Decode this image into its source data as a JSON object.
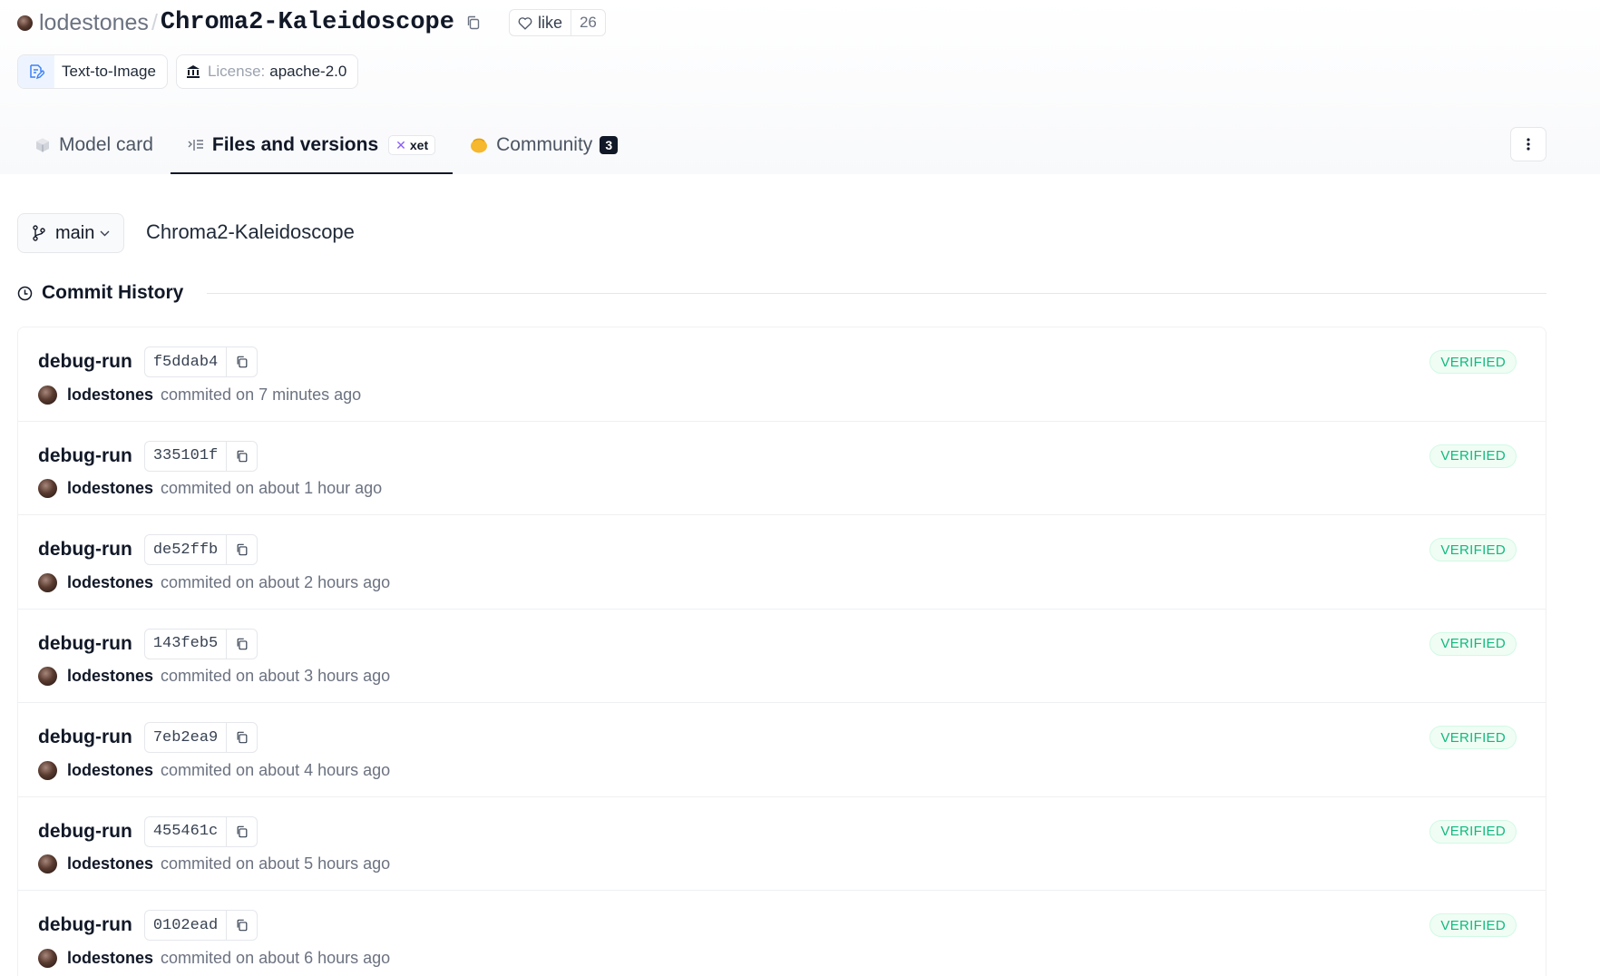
{
  "repo": {
    "owner": "lodestones",
    "separator": "/",
    "name": "Chroma2-Kaleidoscope",
    "like_label": "like",
    "like_count": "26"
  },
  "chips": {
    "task": "Text-to-Image",
    "license_label": "License:",
    "license_value": "apache-2.0"
  },
  "tabs": [
    {
      "label": "Model card",
      "icon": "cube-icon"
    },
    {
      "label": "Files and versions",
      "icon": "files-icon",
      "badge": "xet"
    },
    {
      "label": "Community",
      "icon": "community-icon",
      "count": "3"
    }
  ],
  "branch": {
    "name": "main",
    "crumb": "Chroma2-Kaleidoscope"
  },
  "history": {
    "title": "Commit History"
  },
  "commits": [
    {
      "title": "debug-run",
      "hash": "f5ddab4",
      "author": "lodestones",
      "meta": "commited on 7 minutes ago",
      "status": "VERIFIED"
    },
    {
      "title": "debug-run",
      "hash": "335101f",
      "author": "lodestones",
      "meta": "commited on about 1 hour ago",
      "status": "VERIFIED"
    },
    {
      "title": "debug-run",
      "hash": "de52ffb",
      "author": "lodestones",
      "meta": "commited on about 2 hours ago",
      "status": "VERIFIED"
    },
    {
      "title": "debug-run",
      "hash": "143feb5",
      "author": "lodestones",
      "meta": "commited on about 3 hours ago",
      "status": "VERIFIED"
    },
    {
      "title": "debug-run",
      "hash": "7eb2ea9",
      "author": "lodestones",
      "meta": "commited on about 4 hours ago",
      "status": "VERIFIED"
    },
    {
      "title": "debug-run",
      "hash": "455461c",
      "author": "lodestones",
      "meta": "commited on about 5 hours ago",
      "status": "VERIFIED"
    },
    {
      "title": "debug-run",
      "hash": "0102ead",
      "author": "lodestones",
      "meta": "commited on about 6 hours ago",
      "status": "VERIFIED"
    }
  ],
  "colors": {
    "accent": "#111827",
    "verified": "#10b981",
    "community_icon": "#f5b82e",
    "xet": "#8b5cf6"
  }
}
